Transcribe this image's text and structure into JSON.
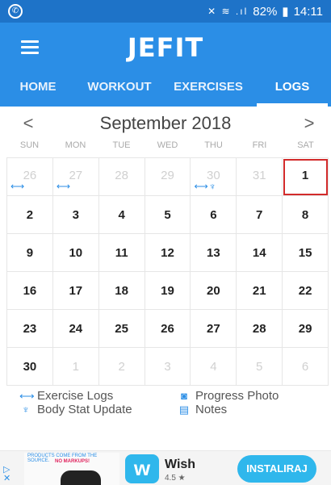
{
  "status_bar": {
    "battery": "82%",
    "time": "14:11",
    "signal_icons": "✕ ≋ .ıl"
  },
  "app": {
    "logo": "JEFIT"
  },
  "tabs": [
    {
      "label": "HOME"
    },
    {
      "label": "WORKOUT"
    },
    {
      "label": "EXERCISES"
    },
    {
      "label": "LOGS",
      "active": true
    }
  ],
  "calendar": {
    "month_title": "September 2018",
    "prev_label": "<",
    "next_label": ">",
    "weekdays": [
      "SUN",
      "MON",
      "TUE",
      "WED",
      "THU",
      "FRI",
      "SAT"
    ],
    "weeks": [
      [
        {
          "day": "26",
          "muted": true,
          "marks": [
            "exercise"
          ]
        },
        {
          "day": "27",
          "muted": true,
          "marks": [
            "exercise"
          ]
        },
        {
          "day": "28",
          "muted": true
        },
        {
          "day": "29",
          "muted": true
        },
        {
          "day": "30",
          "muted": true,
          "marks": [
            "exercise",
            "body"
          ]
        },
        {
          "day": "31",
          "muted": true
        },
        {
          "day": "1",
          "selected": true
        }
      ],
      [
        {
          "day": "2"
        },
        {
          "day": "3"
        },
        {
          "day": "4"
        },
        {
          "day": "5"
        },
        {
          "day": "6"
        },
        {
          "day": "7"
        },
        {
          "day": "8"
        }
      ],
      [
        {
          "day": "9"
        },
        {
          "day": "10"
        },
        {
          "day": "11"
        },
        {
          "day": "12"
        },
        {
          "day": "13"
        },
        {
          "day": "14"
        },
        {
          "day": "15"
        }
      ],
      [
        {
          "day": "16"
        },
        {
          "day": "17"
        },
        {
          "day": "18"
        },
        {
          "day": "19"
        },
        {
          "day": "20"
        },
        {
          "day": "21"
        },
        {
          "day": "22"
        }
      ],
      [
        {
          "day": "23"
        },
        {
          "day": "24"
        },
        {
          "day": "25"
        },
        {
          "day": "26"
        },
        {
          "day": "27"
        },
        {
          "day": "28"
        },
        {
          "day": "29"
        }
      ],
      [
        {
          "day": "30"
        },
        {
          "day": "1",
          "muted": true
        },
        {
          "day": "2",
          "muted": true
        },
        {
          "day": "3",
          "muted": true
        },
        {
          "day": "4",
          "muted": true
        },
        {
          "day": "5",
          "muted": true
        },
        {
          "day": "6",
          "muted": true
        }
      ]
    ]
  },
  "legend": {
    "exercise_logs": "Exercise Logs",
    "progress_photo": "Progress Photo",
    "body_stat_update": "Body Stat Update",
    "notes": "Notes"
  },
  "icons": {
    "exercise": "dumbbell-icon",
    "body": "body-icon",
    "photo": "camera-icon",
    "notes": "notes-icon"
  },
  "ad": {
    "image_text_1": "PRODUCTS COME FROM THE SOURCE.",
    "image_text_2": "NO MARKUPS!",
    "app_name": "Wish",
    "rating": "4.5 ★",
    "install_label": "INSTALIRAJ"
  },
  "colors": {
    "primary": "#2b8ee6",
    "status_bar": "#1e73c8",
    "selected_outline": "#d22b2b",
    "ad_accent": "#2fb7ec"
  }
}
